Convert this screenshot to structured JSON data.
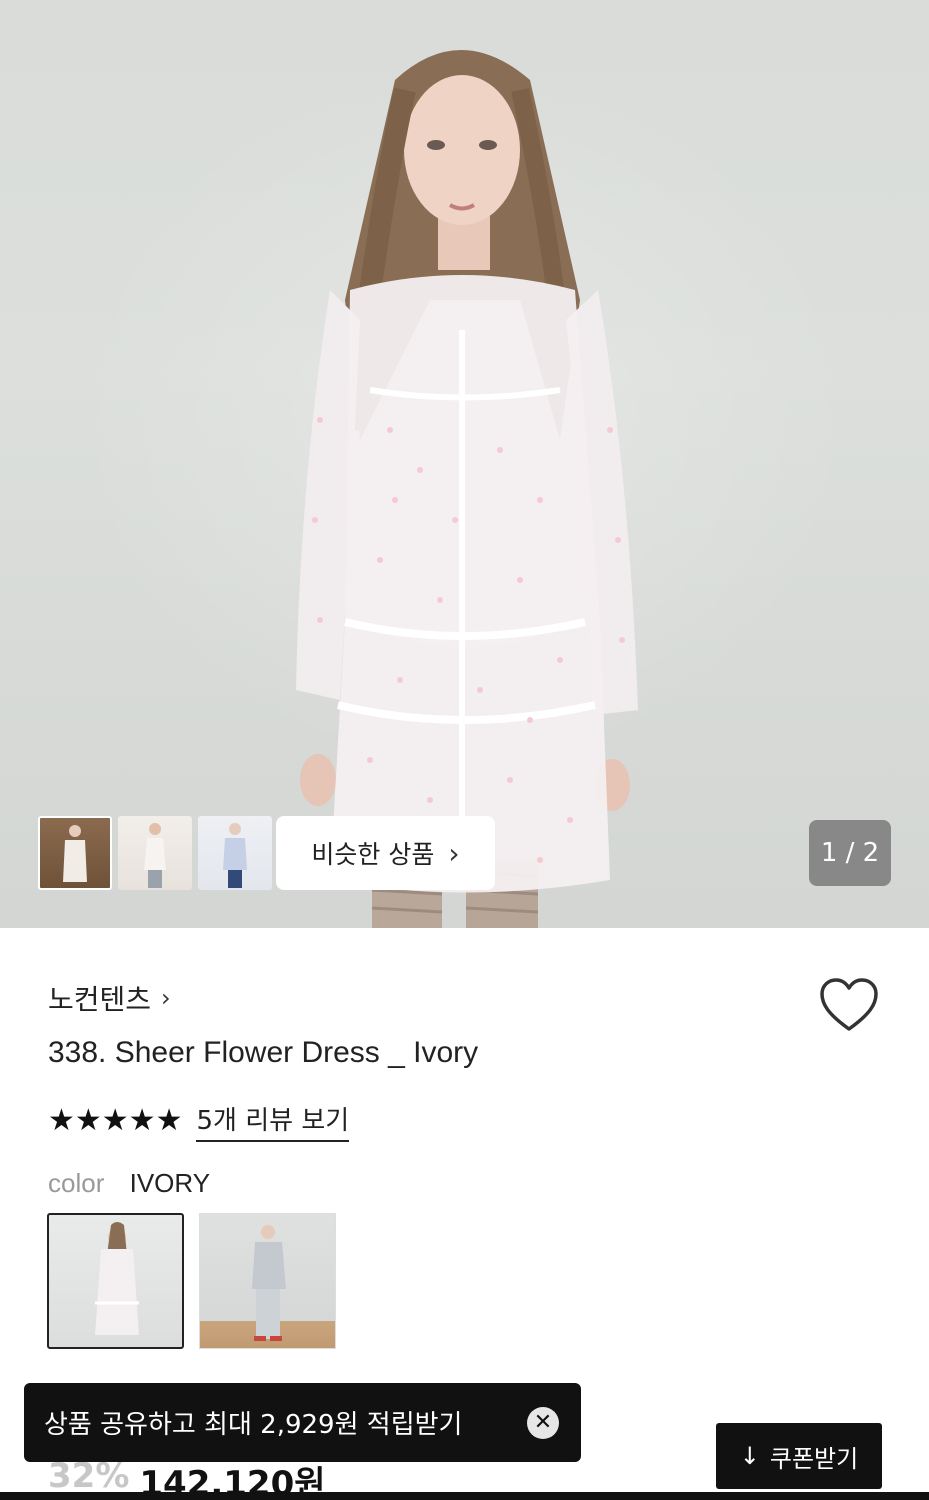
{
  "gallery": {
    "similar_label": "비슷한 상품",
    "similar_chevron": "›",
    "page_indicator": "1 / 2",
    "thumbnails": [
      "thumb-1",
      "thumb-2",
      "thumb-3"
    ]
  },
  "product": {
    "brand": "노컨텐츠",
    "brand_chevron": "›",
    "title": "338. Sheer Flower Dress _ Ivory",
    "stars": "★★★★★",
    "review_link": "5개 리뷰 보기",
    "rating_stars": 5,
    "color_label": "color",
    "color_value": "IVORY",
    "discount": "32%",
    "price": "142,120원"
  },
  "toast": {
    "message": "상품 공유하고 최대 2,929원 적립받기",
    "close_symbol": "✕"
  },
  "coupon": {
    "label": "쿠폰받기",
    "icon": "↓"
  },
  "icons": {
    "heart": "heart-icon",
    "download": "download-icon",
    "close": "close-icon",
    "star": "star-icon"
  }
}
